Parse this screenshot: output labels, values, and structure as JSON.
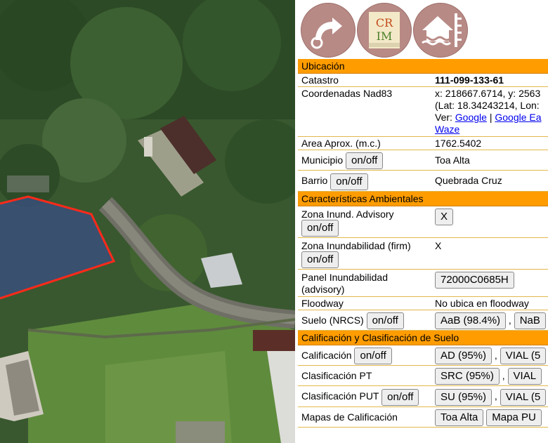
{
  "map": {
    "accent": "#ff2a1a"
  },
  "logos": [
    {
      "name": "arrow-logo-icon"
    },
    {
      "name": "crim-logo-icon",
      "text": "CRIM"
    },
    {
      "name": "flood-house-logo-icon"
    }
  ],
  "ubicacion": {
    "header": "Ubicación",
    "catastro_label": "Catastro",
    "catastro_value": "111-099-133-61",
    "coord_label": "Coordenadas Nad83",
    "coord_line1": "x: 218667.6714, y: 2563",
    "coord_line2": "(Lat: 18.34243214, Lon:",
    "ver_label": "Ver:",
    "links": [
      "Google",
      "Google Ea",
      "Waze"
    ],
    "area_label": "Area Aprox. (m.c.)",
    "area_value": "1762.5402",
    "municipio_label": "Municipio",
    "municipio_value": "Toa Alta",
    "barrio_label": "Barrio",
    "barrio_value": "Quebrada Cruz",
    "onoff": "on/off"
  },
  "ambientales": {
    "header": "Características Ambientales",
    "zona_adv_label": "Zona Inund. Advisory",
    "zona_adv_value": "X",
    "zona_firm_label": "Zona Inundabilidad (firm)",
    "zona_firm_value": "X",
    "panel_label1": "Panel Inundabilidad",
    "panel_label2": "(advisory)",
    "panel_value": "72000C0685H",
    "floodway_label": "Floodway",
    "floodway_value": "No ubica en floodway",
    "suelo_label": "Suelo (NRCS)",
    "suelo_values": [
      "AaB (98.4%)",
      "NaB"
    ]
  },
  "calificacion": {
    "header": "Calificación y Clasificación de Suelo",
    "calif_label": "Calificación",
    "calif_values": [
      "AD (95%)",
      "VIAL (5"
    ],
    "clas_pt_label": "Clasificación PT",
    "clas_pt_values": [
      "SRC (95%)",
      "VIAL"
    ],
    "clas_put_label": "Clasificación PUT",
    "clas_put_values": [
      "SU (95%)",
      "VIAL (5"
    ],
    "mapas_label": "Mapas de Calificación",
    "mapas_values": [
      "Toa Alta",
      "Mapa PU"
    ]
  }
}
